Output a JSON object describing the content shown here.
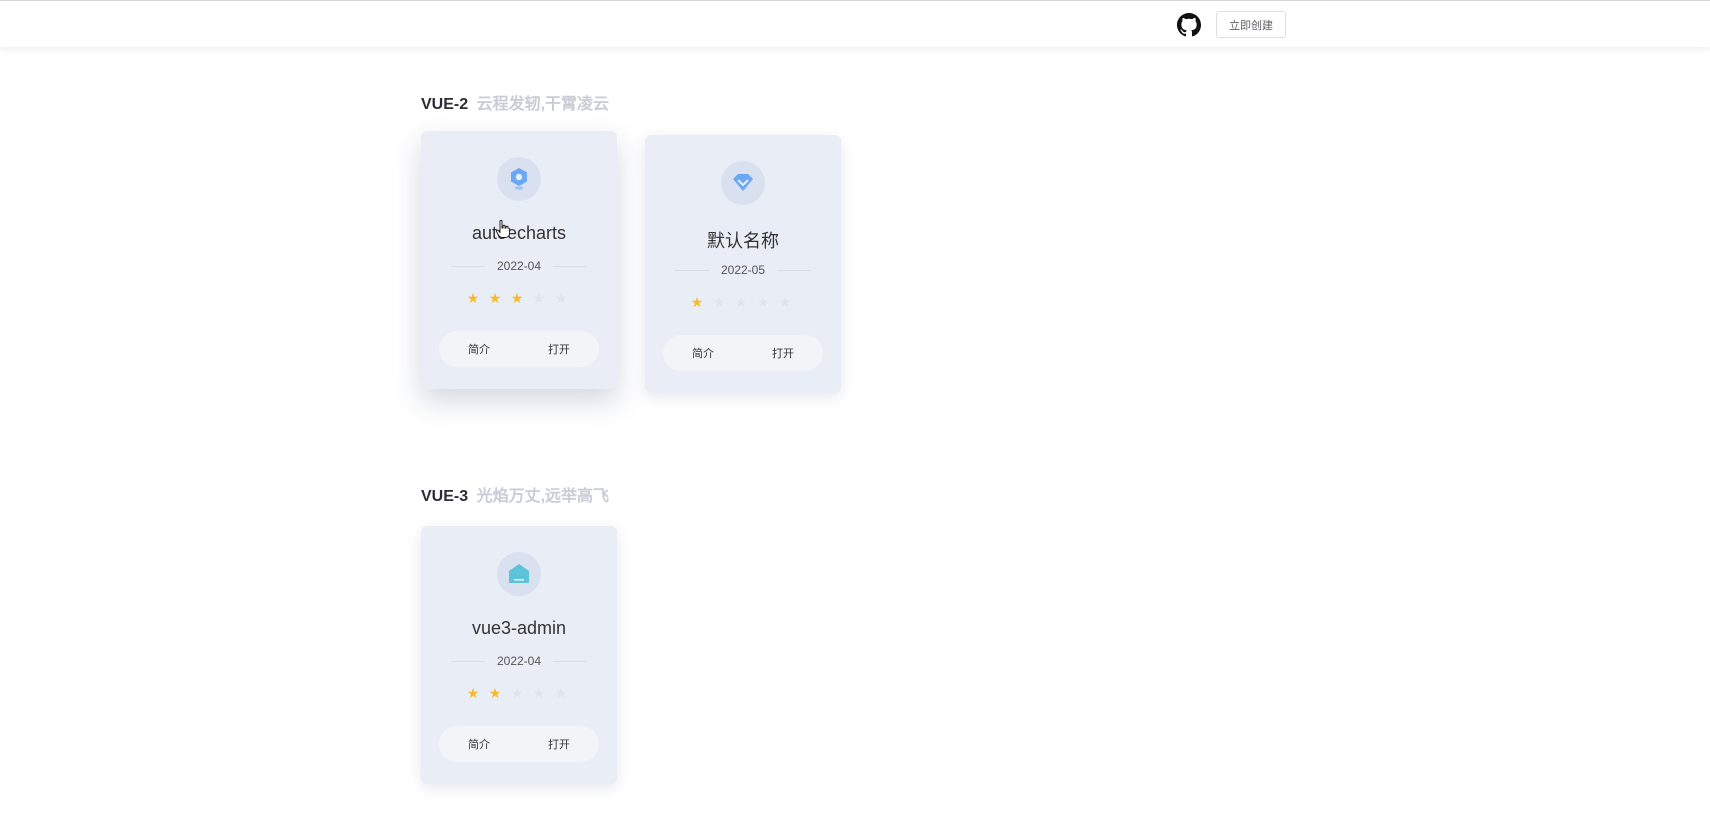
{
  "header": {
    "github_icon": "github-icon",
    "create_label": "立即创建"
  },
  "sections": [
    {
      "version": "VUE-2",
      "slogan": "云程发轫,干霄凌云",
      "cards": [
        {
          "icon": "wrench-gear-icon",
          "icon_color": "#6aa7f4",
          "name": "autoecharts",
          "date": "2022-04",
          "rating": 3,
          "max_rating": 5,
          "intro_label": "简介",
          "open_label": "打开"
        },
        {
          "icon": "diamond-icon",
          "icon_color": "#6aa7f4",
          "name": "默认名称",
          "date": "2022-05",
          "rating": 1,
          "max_rating": 5,
          "intro_label": "简介",
          "open_label": "打开"
        }
      ]
    },
    {
      "version": "VUE-3",
      "slogan": "光焰万丈,远举高飞",
      "cards": [
        {
          "icon": "home-icon",
          "icon_color": "#5cc3d9",
          "name": "vue3-admin",
          "date": "2022-04",
          "rating": 2,
          "max_rating": 5,
          "intro_label": "简介",
          "open_label": "打开"
        }
      ]
    }
  ],
  "colors": {
    "card_bg": "#e9edf5",
    "star_on": "#f7ba2a",
    "star_off": "#e0e4ec",
    "title_dark": "#2c2c35",
    "slogan": "#c8ccd4"
  }
}
